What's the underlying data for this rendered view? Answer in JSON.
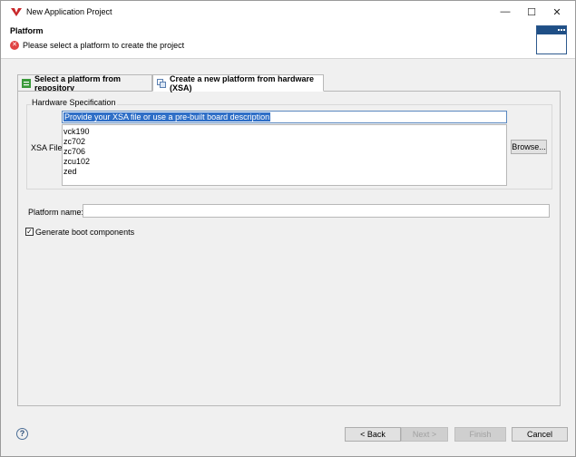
{
  "window": {
    "title": "New Application Project",
    "minimize_glyph": "—",
    "maximize_glyph": "☐",
    "close_glyph": "✕"
  },
  "header": {
    "title": "Platform",
    "message": "Please select a platform to create the project",
    "error_glyph": "✕"
  },
  "tabs": [
    {
      "label": "Select a platform from repository",
      "icon": "repository-icon",
      "selected": false
    },
    {
      "label": "Create a new platform from hardware (XSA)",
      "icon": "hardware-platform-icon",
      "selected": true
    }
  ],
  "hardware_spec": {
    "group_label": "Hardware Specification",
    "xsa_label": "XSA File:",
    "combo_value": "Provide your XSA file or use a pre-built board description",
    "boards": [
      "vck190",
      "zc702",
      "zc706",
      "zcu102",
      "zed"
    ],
    "browse_label": "Browse..."
  },
  "platform_name": {
    "label": "Platform name:",
    "value": ""
  },
  "boot": {
    "label": "Generate boot components",
    "checked": true,
    "check_glyph": "✓"
  },
  "footer": {
    "help_glyph": "?",
    "back_label": "< Back",
    "next_label": "Next >",
    "finish_label": "Finish",
    "cancel_label": "Cancel",
    "next_enabled": false,
    "finish_enabled": false
  },
  "colors": {
    "accent_selection": "#2f6fc7",
    "error_red": "#e04343",
    "banner_blue": "#1f4f86"
  }
}
